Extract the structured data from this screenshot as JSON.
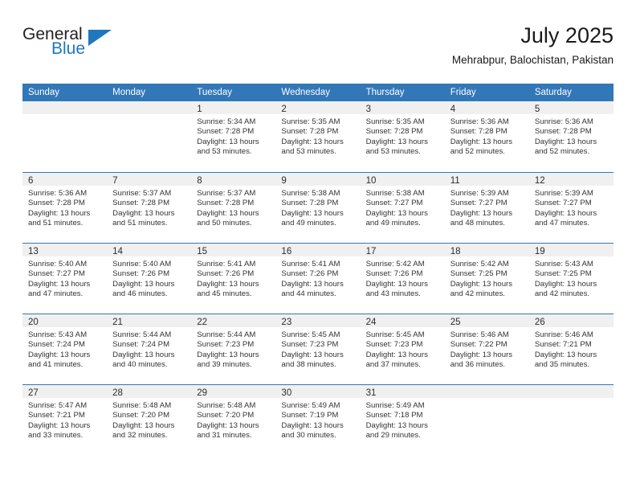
{
  "brand": {
    "name_top": "General",
    "name_bottom": "Blue",
    "accent_color": "#1f77bc"
  },
  "header": {
    "title": "July 2025",
    "subtitle": "Mehrabpur, Balochistan, Pakistan"
  },
  "colors": {
    "header_blue": "#3277b8",
    "day_strip_gray": "#f0f0f0",
    "text": "#333333"
  },
  "weekdays": [
    "Sunday",
    "Monday",
    "Tuesday",
    "Wednesday",
    "Thursday",
    "Friday",
    "Saturday"
  ],
  "labels": {
    "sunrise": "Sunrise:",
    "sunset": "Sunset:",
    "daylight": "Daylight:"
  },
  "weeks": [
    [
      {
        "day": "",
        "empty": true
      },
      {
        "day": "",
        "empty": true
      },
      {
        "day": "1",
        "sunrise": "Sunrise: 5:34 AM",
        "sunset": "Sunset: 7:28 PM",
        "daylight": "Daylight: 13 hours and 53 minutes."
      },
      {
        "day": "2",
        "sunrise": "Sunrise: 5:35 AM",
        "sunset": "Sunset: 7:28 PM",
        "daylight": "Daylight: 13 hours and 53 minutes."
      },
      {
        "day": "3",
        "sunrise": "Sunrise: 5:35 AM",
        "sunset": "Sunset: 7:28 PM",
        "daylight": "Daylight: 13 hours and 53 minutes."
      },
      {
        "day": "4",
        "sunrise": "Sunrise: 5:36 AM",
        "sunset": "Sunset: 7:28 PM",
        "daylight": "Daylight: 13 hours and 52 minutes."
      },
      {
        "day": "5",
        "sunrise": "Sunrise: 5:36 AM",
        "sunset": "Sunset: 7:28 PM",
        "daylight": "Daylight: 13 hours and 52 minutes."
      }
    ],
    [
      {
        "day": "6",
        "sunrise": "Sunrise: 5:36 AM",
        "sunset": "Sunset: 7:28 PM",
        "daylight": "Daylight: 13 hours and 51 minutes."
      },
      {
        "day": "7",
        "sunrise": "Sunrise: 5:37 AM",
        "sunset": "Sunset: 7:28 PM",
        "daylight": "Daylight: 13 hours and 51 minutes."
      },
      {
        "day": "8",
        "sunrise": "Sunrise: 5:37 AM",
        "sunset": "Sunset: 7:28 PM",
        "daylight": "Daylight: 13 hours and 50 minutes."
      },
      {
        "day": "9",
        "sunrise": "Sunrise: 5:38 AM",
        "sunset": "Sunset: 7:28 PM",
        "daylight": "Daylight: 13 hours and 49 minutes."
      },
      {
        "day": "10",
        "sunrise": "Sunrise: 5:38 AM",
        "sunset": "Sunset: 7:27 PM",
        "daylight": "Daylight: 13 hours and 49 minutes."
      },
      {
        "day": "11",
        "sunrise": "Sunrise: 5:39 AM",
        "sunset": "Sunset: 7:27 PM",
        "daylight": "Daylight: 13 hours and 48 minutes."
      },
      {
        "day": "12",
        "sunrise": "Sunrise: 5:39 AM",
        "sunset": "Sunset: 7:27 PM",
        "daylight": "Daylight: 13 hours and 47 minutes."
      }
    ],
    [
      {
        "day": "13",
        "sunrise": "Sunrise: 5:40 AM",
        "sunset": "Sunset: 7:27 PM",
        "daylight": "Daylight: 13 hours and 47 minutes."
      },
      {
        "day": "14",
        "sunrise": "Sunrise: 5:40 AM",
        "sunset": "Sunset: 7:26 PM",
        "daylight": "Daylight: 13 hours and 46 minutes."
      },
      {
        "day": "15",
        "sunrise": "Sunrise: 5:41 AM",
        "sunset": "Sunset: 7:26 PM",
        "daylight": "Daylight: 13 hours and 45 minutes."
      },
      {
        "day": "16",
        "sunrise": "Sunrise: 5:41 AM",
        "sunset": "Sunset: 7:26 PM",
        "daylight": "Daylight: 13 hours and 44 minutes."
      },
      {
        "day": "17",
        "sunrise": "Sunrise: 5:42 AM",
        "sunset": "Sunset: 7:26 PM",
        "daylight": "Daylight: 13 hours and 43 minutes."
      },
      {
        "day": "18",
        "sunrise": "Sunrise: 5:42 AM",
        "sunset": "Sunset: 7:25 PM",
        "daylight": "Daylight: 13 hours and 42 minutes."
      },
      {
        "day": "19",
        "sunrise": "Sunrise: 5:43 AM",
        "sunset": "Sunset: 7:25 PM",
        "daylight": "Daylight: 13 hours and 42 minutes."
      }
    ],
    [
      {
        "day": "20",
        "sunrise": "Sunrise: 5:43 AM",
        "sunset": "Sunset: 7:24 PM",
        "daylight": "Daylight: 13 hours and 41 minutes."
      },
      {
        "day": "21",
        "sunrise": "Sunrise: 5:44 AM",
        "sunset": "Sunset: 7:24 PM",
        "daylight": "Daylight: 13 hours and 40 minutes."
      },
      {
        "day": "22",
        "sunrise": "Sunrise: 5:44 AM",
        "sunset": "Sunset: 7:23 PM",
        "daylight": "Daylight: 13 hours and 39 minutes."
      },
      {
        "day": "23",
        "sunrise": "Sunrise: 5:45 AM",
        "sunset": "Sunset: 7:23 PM",
        "daylight": "Daylight: 13 hours and 38 minutes."
      },
      {
        "day": "24",
        "sunrise": "Sunrise: 5:45 AM",
        "sunset": "Sunset: 7:23 PM",
        "daylight": "Daylight: 13 hours and 37 minutes."
      },
      {
        "day": "25",
        "sunrise": "Sunrise: 5:46 AM",
        "sunset": "Sunset: 7:22 PM",
        "daylight": "Daylight: 13 hours and 36 minutes."
      },
      {
        "day": "26",
        "sunrise": "Sunrise: 5:46 AM",
        "sunset": "Sunset: 7:21 PM",
        "daylight": "Daylight: 13 hours and 35 minutes."
      }
    ],
    [
      {
        "day": "27",
        "sunrise": "Sunrise: 5:47 AM",
        "sunset": "Sunset: 7:21 PM",
        "daylight": "Daylight: 13 hours and 33 minutes."
      },
      {
        "day": "28",
        "sunrise": "Sunrise: 5:48 AM",
        "sunset": "Sunset: 7:20 PM",
        "daylight": "Daylight: 13 hours and 32 minutes."
      },
      {
        "day": "29",
        "sunrise": "Sunrise: 5:48 AM",
        "sunset": "Sunset: 7:20 PM",
        "daylight": "Daylight: 13 hours and 31 minutes."
      },
      {
        "day": "30",
        "sunrise": "Sunrise: 5:49 AM",
        "sunset": "Sunset: 7:19 PM",
        "daylight": "Daylight: 13 hours and 30 minutes."
      },
      {
        "day": "31",
        "sunrise": "Sunrise: 5:49 AM",
        "sunset": "Sunset: 7:18 PM",
        "daylight": "Daylight: 13 hours and 29 minutes."
      },
      {
        "day": "",
        "empty": true
      },
      {
        "day": "",
        "empty": true
      }
    ]
  ]
}
